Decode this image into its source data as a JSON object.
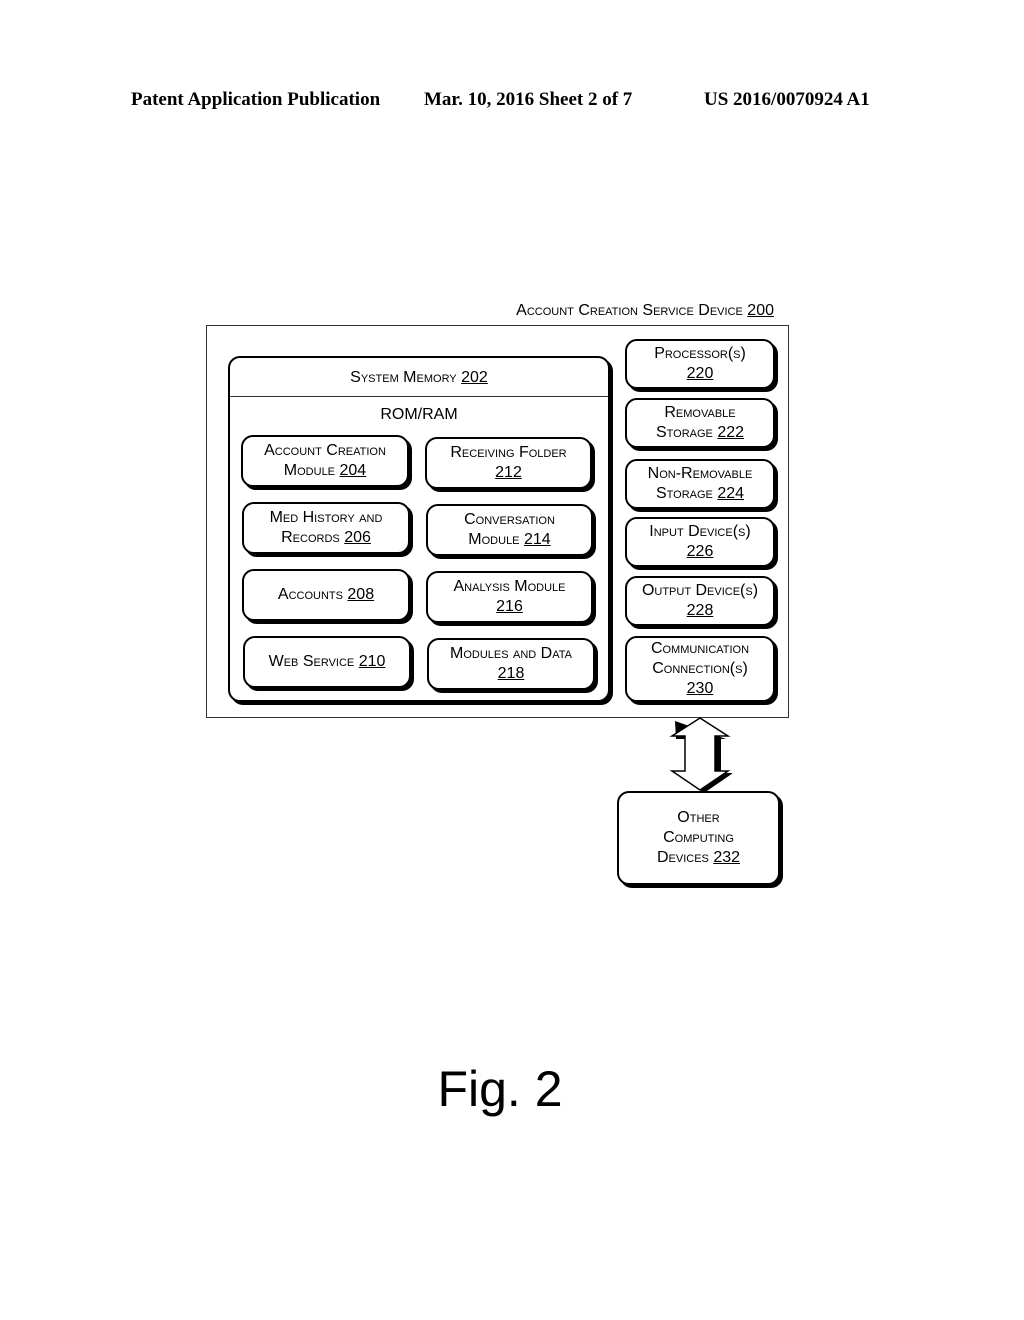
{
  "header": {
    "publication": "Patent Application Publication",
    "date_sheet": "Mar. 10, 2016  Sheet 2 of 7",
    "number": "US 2016/0070924 A1"
  },
  "device": {
    "label": "Account Creation Service Device",
    "ref": "200"
  },
  "memory": {
    "label": "System Memory",
    "ref": "202",
    "sublabel": "ROM/RAM",
    "modules": [
      {
        "line1": "Account Creation",
        "line2": "Module",
        "ref": "204"
      },
      {
        "line1": "Receiving Folder",
        "line2": "",
        "ref": "212"
      },
      {
        "line1": "Med History and",
        "line2": "Records",
        "ref": "206"
      },
      {
        "line1": "Conversation",
        "line2": "Module",
        "ref": "214"
      },
      {
        "line1": "",
        "line2": "Accounts",
        "ref": "208"
      },
      {
        "line1": "Analysis Module",
        "line2": "",
        "ref": "216"
      },
      {
        "line1": "",
        "line2": "Web Service",
        "ref": "210"
      },
      {
        "line1": "Modules and Data",
        "line2": "",
        "ref": "218"
      }
    ]
  },
  "components": [
    {
      "line1": "Processor(s)",
      "line2": "",
      "ref": "220"
    },
    {
      "line1": "Removable",
      "line2": "Storage",
      "ref": "222"
    },
    {
      "line1": "Non-Removable",
      "line2": "Storage",
      "ref": "224"
    },
    {
      "line1": "Input Device(s)",
      "line2": "",
      "ref": "226"
    },
    {
      "line1": "Output Device(s)",
      "line2": "",
      "ref": "228"
    },
    {
      "line1": "Communication",
      "line2": "Connection(s)",
      "ref": "230"
    }
  ],
  "external": {
    "line1": "Other",
    "line2": "Computing",
    "line3": "Devices",
    "ref": "232"
  },
  "figure_label": "Fig. 2"
}
